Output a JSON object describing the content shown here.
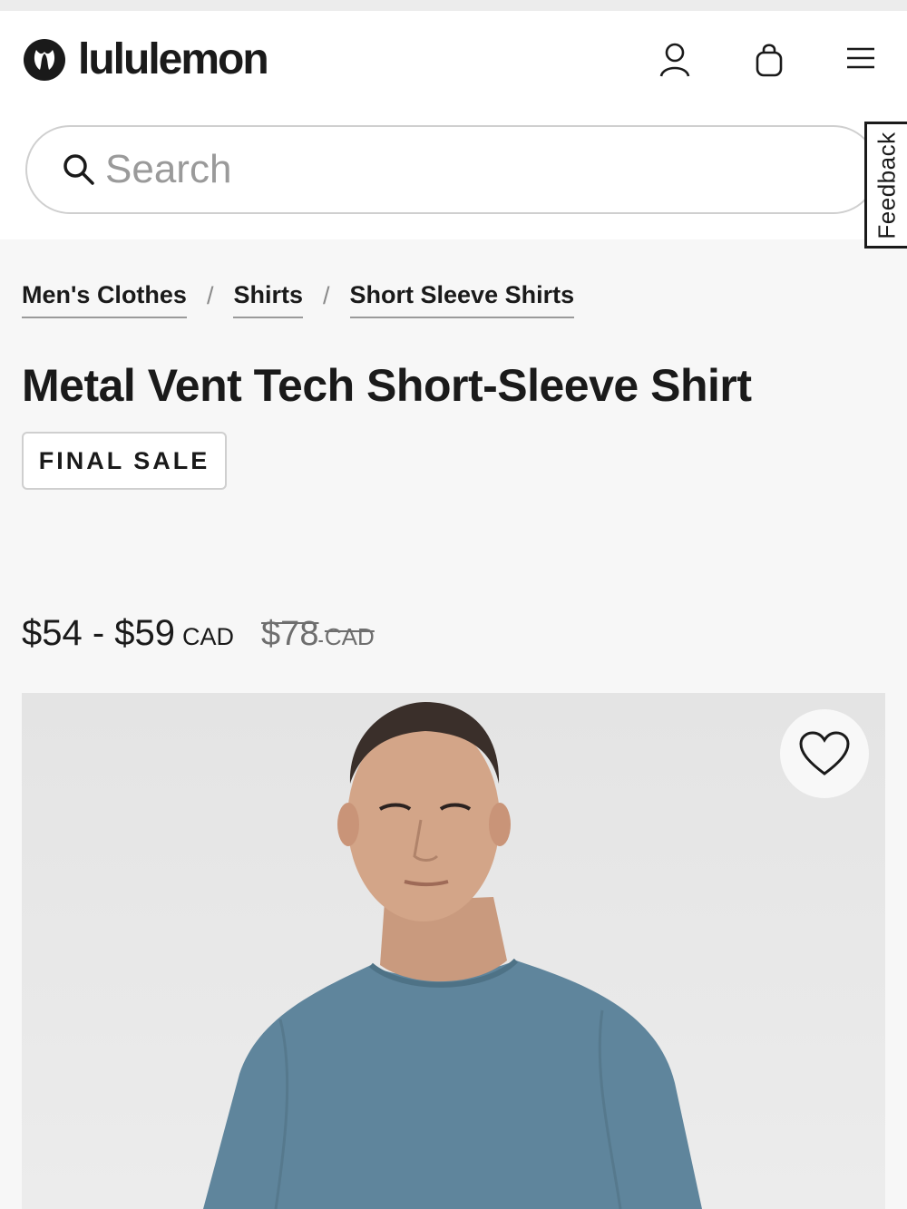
{
  "brand": {
    "name": "lululemon",
    "logo_icon": "lululemon-logo-icon"
  },
  "header": {
    "account_icon": "user-icon",
    "bag_icon": "shopping-bag-icon",
    "menu_icon": "hamburger-menu-icon"
  },
  "search": {
    "placeholder": "Search",
    "value": "",
    "icon": "search-icon"
  },
  "feedback": {
    "label": "Feedback"
  },
  "breadcrumb": {
    "items": [
      {
        "label": "Men's Clothes"
      },
      {
        "label": "Shirts"
      },
      {
        "label": "Short Sleeve Shirts"
      }
    ],
    "separator": "/"
  },
  "product": {
    "title": "Metal Vent Tech Short-Sleeve Shirt",
    "badge": "FINAL SALE",
    "price_range": "$54 - $59",
    "currency": "CAD",
    "original_price": "$78",
    "original_currency": "CAD",
    "favorite_icon": "heart-icon",
    "shirt_color": "#5f859c"
  }
}
